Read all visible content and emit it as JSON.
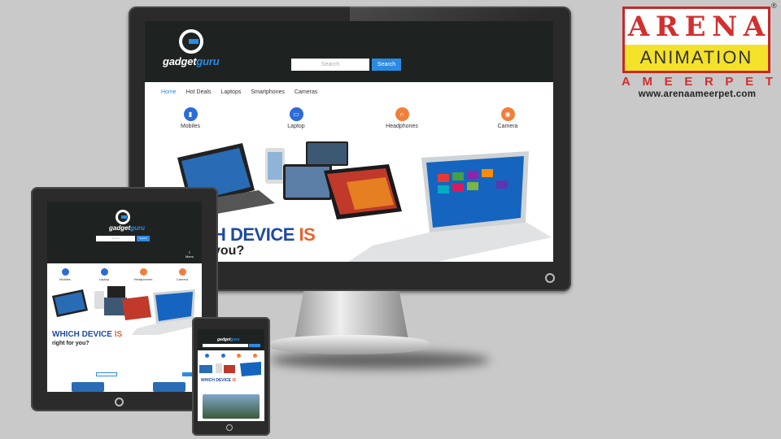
{
  "brand": {
    "logo_gadget": "gadget",
    "logo_guru": "guru"
  },
  "search": {
    "placeholder": "Search",
    "button": "Search"
  },
  "nav": {
    "items": [
      "Home",
      "Hot Deals",
      "Laptops",
      "Smartphones",
      "Cameras"
    ]
  },
  "categories": [
    {
      "label": "Mobiles",
      "icon": "mobile-icon",
      "color": "#2b6cd6"
    },
    {
      "label": "Laptop",
      "icon": "laptop-icon",
      "color": "#2b6cd6"
    },
    {
      "label": "Headphones",
      "icon": "headphones-icon",
      "color": "#f07f3c"
    },
    {
      "label": "Camera",
      "icon": "camera-icon",
      "color": "#f07f3c"
    }
  ],
  "hero": {
    "line1": "WHICH DEVICE",
    "line1_accent": "IS",
    "line2": "right for you?",
    "monitor_line1": "H DEVICE",
    "monitor_line2": "you?"
  },
  "tablet": {
    "menu_label": "Menu"
  },
  "arena": {
    "top_letters": [
      "A",
      "R",
      "E",
      "N",
      "A"
    ],
    "mid": "ANIMATION",
    "city_letters": [
      "A",
      "M",
      "E",
      "E",
      "R",
      "P",
      "E",
      "T"
    ],
    "website": "www.arenaameerpet.com",
    "reg": "®"
  },
  "colors": {
    "accent": "#2b8be3",
    "header_bg": "#1e2321",
    "hero_blue": "#1e4aa0",
    "hero_orange": "#e8622a",
    "arena_red": "#d32f2f",
    "arena_yellow": "#f4e22a"
  }
}
